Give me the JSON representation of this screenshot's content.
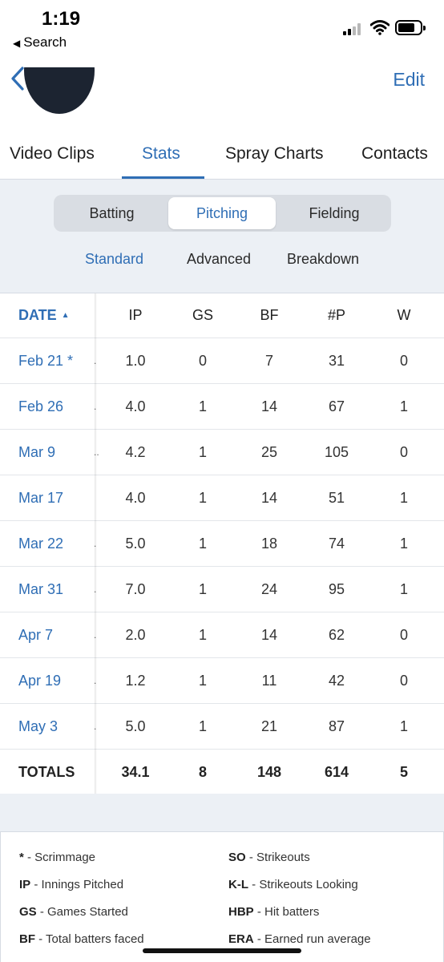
{
  "status_bar": {
    "time": "1:19",
    "back_app": "Search",
    "signal_icon": "signal-icon",
    "wifi_icon": "wifi-icon",
    "battery_icon": "battery-icon"
  },
  "nav": {
    "back_icon": "chevron-left-icon",
    "edit_label": "Edit"
  },
  "tabs": [
    {
      "label": "Video Clips",
      "active": false
    },
    {
      "label": "Stats",
      "active": true
    },
    {
      "label": "Spray Charts",
      "active": false
    },
    {
      "label": "Contacts",
      "active": false
    }
  ],
  "segment": [
    {
      "label": "Batting",
      "active": false
    },
    {
      "label": "Pitching",
      "active": true
    },
    {
      "label": "Fielding",
      "active": false
    }
  ],
  "subtabs": [
    {
      "label": "Standard",
      "active": true
    },
    {
      "label": "Advanced",
      "active": false
    },
    {
      "label": "Breakdown",
      "active": false
    }
  ],
  "table": {
    "columns": [
      "DATE",
      "IP",
      "GS",
      "BF",
      "#P",
      "W"
    ],
    "sort_indicator": "▲",
    "rows": [
      {
        "date": "Feb 21 *",
        "dots": ".",
        "ip": "1.0",
        "gs": "0",
        "bf": "7",
        "p": "31",
        "w": "0"
      },
      {
        "date": "Feb 26",
        "dots": ".",
        "ip": "4.0",
        "gs": "1",
        "bf": "14",
        "p": "67",
        "w": "1"
      },
      {
        "date": "Mar 9",
        "dots": "..",
        "ip": "4.2",
        "gs": "1",
        "bf": "25",
        "p": "105",
        "w": "0"
      },
      {
        "date": "Mar 17",
        "dots": "",
        "ip": "4.0",
        "gs": "1",
        "bf": "14",
        "p": "51",
        "w": "1"
      },
      {
        "date": "Mar 22",
        "dots": ".",
        "ip": "5.0",
        "gs": "1",
        "bf": "18",
        "p": "74",
        "w": "1"
      },
      {
        "date": "Mar 31",
        "dots": ".",
        "ip": "7.0",
        "gs": "1",
        "bf": "24",
        "p": "95",
        "w": "1"
      },
      {
        "date": "Apr 7",
        "dots": ".",
        "ip": "2.0",
        "gs": "1",
        "bf": "14",
        "p": "62",
        "w": "0"
      },
      {
        "date": "Apr 19",
        "dots": ".",
        "ip": "1.2",
        "gs": "1",
        "bf": "11",
        "p": "42",
        "w": "0"
      },
      {
        "date": "May 3",
        "dots": ".",
        "ip": "5.0",
        "gs": "1",
        "bf": "21",
        "p": "87",
        "w": "1"
      }
    ],
    "totals": {
      "label": "TOTALS",
      "ip": "34.1",
      "gs": "8",
      "bf": "148",
      "p": "614",
      "w": "5"
    }
  },
  "legend": {
    "left": [
      {
        "abbr": "*",
        "desc": " - Scrimmage"
      },
      {
        "abbr": "IP",
        "desc": " - Innings Pitched"
      },
      {
        "abbr": "GS",
        "desc": " - Games Started"
      },
      {
        "abbr": "BF",
        "desc": " - Total batters faced"
      }
    ],
    "right": [
      {
        "abbr": "SO",
        "desc": " - Strikeouts"
      },
      {
        "abbr": "K-L",
        "desc": " - Strikeouts Looking"
      },
      {
        "abbr": "HBP",
        "desc": " - Hit batters"
      },
      {
        "abbr": "ERA",
        "desc": " - Earned run average"
      }
    ]
  },
  "colors": {
    "accent": "#2f6eb5",
    "panel": "#ecf0f5",
    "segment_bg": "#d9dde3"
  }
}
